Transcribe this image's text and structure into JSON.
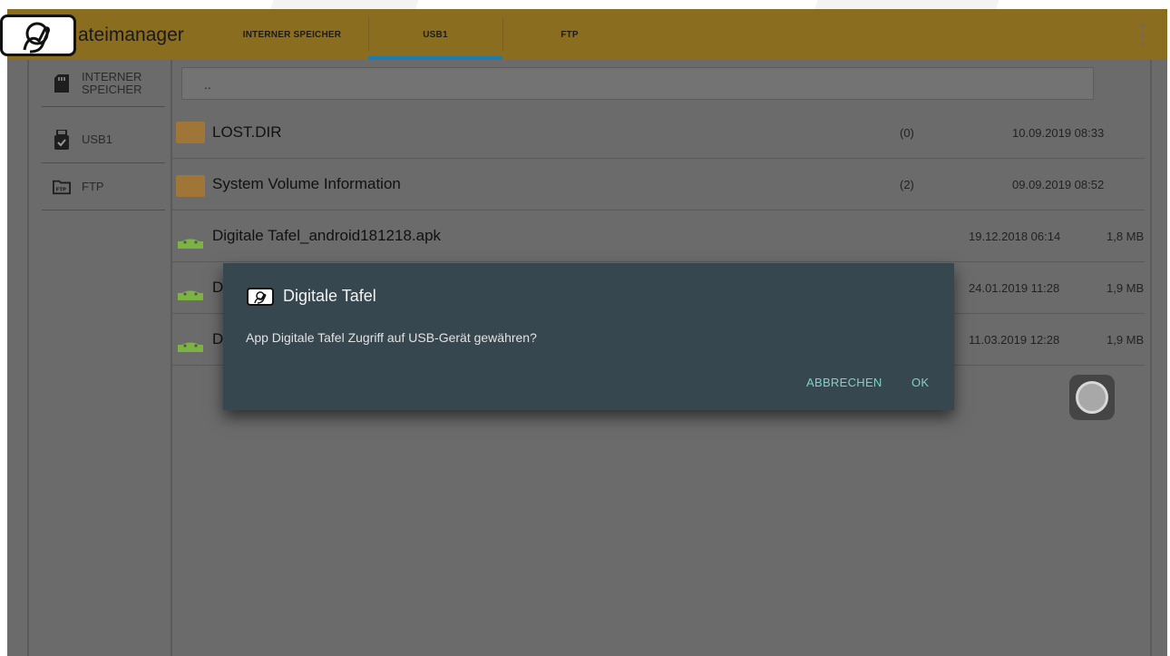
{
  "app": {
    "title": "ateimanager",
    "accent_color": "#8a6d1f",
    "tab_indicator_color": "#1e7bb0"
  },
  "tabs": [
    {
      "label": "INTERNER SPEICHER"
    },
    {
      "label": "USB1",
      "active": true
    },
    {
      "label": "FTP"
    }
  ],
  "sidebar": {
    "items": [
      {
        "label_line1": "INTERNER",
        "label_line2": "SPEICHER",
        "icon": "sd-card-icon"
      },
      {
        "label": "USB1",
        "icon": "usb-drive-icon"
      },
      {
        "label": "FTP",
        "icon": "ftp-icon"
      }
    ]
  },
  "files": {
    "up_label": "..",
    "rows": [
      {
        "name": "LOST.DIR",
        "count": "(0)",
        "date": "10.09.2019 08:33",
        "size": "",
        "type": "folder"
      },
      {
        "name": "System Volume Information",
        "count": "(2)",
        "date": "09.09.2019 08:52",
        "size": "",
        "type": "folder"
      },
      {
        "name": "Digitale Tafel_android181218.apk",
        "count": "",
        "date": "19.12.2018 06:14",
        "size": "1,8 MB",
        "type": "apk"
      },
      {
        "name": "D",
        "count": "",
        "date": "24.01.2019 11:28",
        "size": "1,9 MB",
        "type": "apk"
      },
      {
        "name": "D",
        "count": "",
        "date": "11.03.2019 12:28",
        "size": "1,9 MB",
        "type": "apk"
      }
    ]
  },
  "dialog": {
    "title": "Digitale Tafel",
    "message": "App Digitale Tafel Zugriff auf USB-Gerät gewähren?",
    "cancel_label": "ABBRECHEN",
    "ok_label": "OK",
    "bg_color": "#37474f",
    "button_color": "#7fd1c8"
  }
}
